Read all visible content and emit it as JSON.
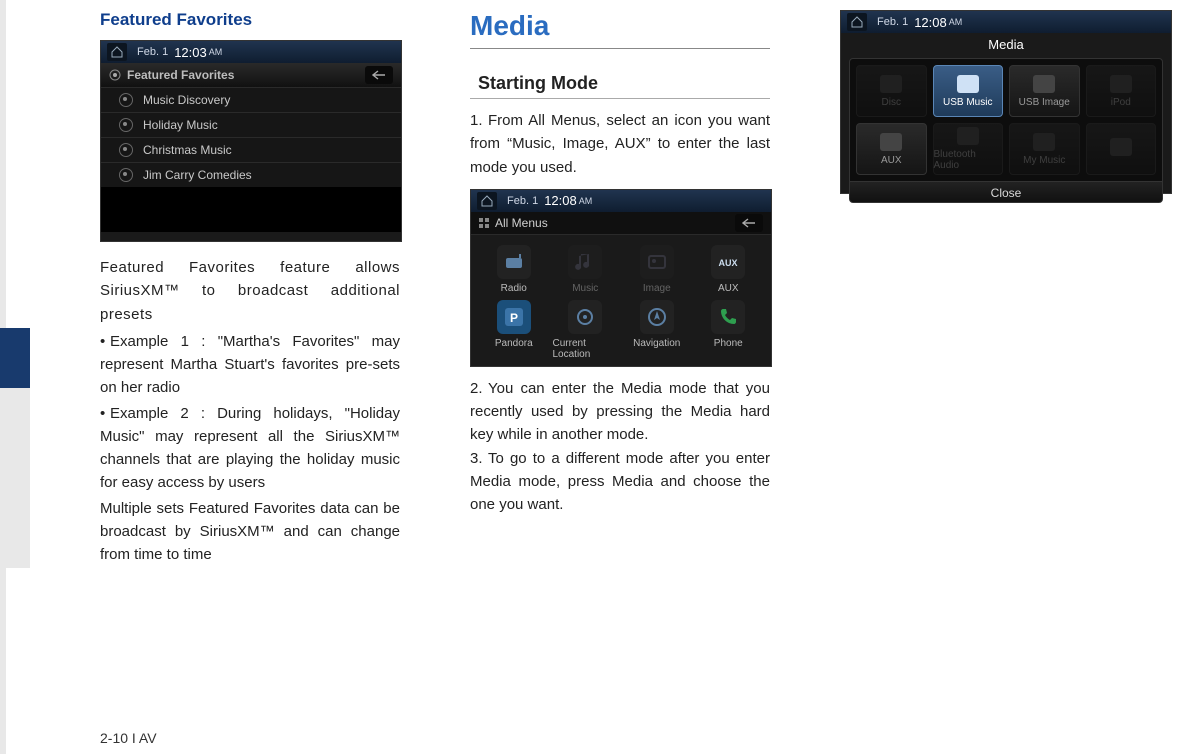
{
  "col1": {
    "heading": "Featured Favorites",
    "shot": {
      "date": "Feb.  1",
      "time": "12:03",
      "ampm": "AM",
      "title": "Featured Favorites",
      "items": [
        "Music Discovery",
        "Holiday Music",
        "Christmas Music",
        "Jim Carry Comedies"
      ]
    },
    "para1": "Featured Favorites feature allows SiriusXM™ to broadcast additional presets",
    "bullet1": "Example 1 : \"Martha's Favorites\" may represent Martha Stuart's favorites pre-sets on her radio",
    "bullet2": "Example 2 : During holidays, \"Holiday Music\" may represent all the SiriusXM™ channels that are playing the holiday music for easy access by users",
    "para2": "Multiple sets Featured Favorites data can be broadcast by SiriusXM™ and can change from time to time"
  },
  "col2": {
    "heading": "Media",
    "sub": "Starting Mode",
    "step1": "From All Menus, select an icon you want from “Music, Image, AUX” to enter the last mode you used.",
    "shot": {
      "date": "Feb.  1",
      "time": "12:08",
      "ampm": "AM",
      "title": "All Menus",
      "cells": [
        {
          "label": "Radio",
          "dim": false
        },
        {
          "label": "Music",
          "dim": true
        },
        {
          "label": "Image",
          "dim": true
        },
        {
          "label": "AUX",
          "dim": false
        },
        {
          "label": "Pandora",
          "dim": false
        },
        {
          "label": "Current Location",
          "dim": false
        },
        {
          "label": "Navigation",
          "dim": false
        },
        {
          "label": "Phone",
          "dim": false
        }
      ]
    },
    "step2": "You can enter the Media mode that you recently used by pressing the Media hard key while in another mode.",
    "step3": "To go to a different mode after you enter Media mode, press Media and choose the one you want."
  },
  "col3": {
    "shot": {
      "date": "Feb.  1",
      "time": "12:08",
      "ampm": "AM",
      "title": "Media",
      "tiles": [
        {
          "label": "Disc",
          "state": "dim"
        },
        {
          "label": "USB Music",
          "state": "sel"
        },
        {
          "label": "USB Image",
          "state": ""
        },
        {
          "label": "iPod",
          "state": "dim"
        },
        {
          "label": "AUX",
          "state": ""
        },
        {
          "label": "Bluetooth Audio",
          "state": "dim"
        },
        {
          "label": "My Music",
          "state": "dim"
        },
        {
          "label": "",
          "state": "dim"
        }
      ],
      "close": "Close"
    }
  },
  "footer": "2-10 I AV"
}
